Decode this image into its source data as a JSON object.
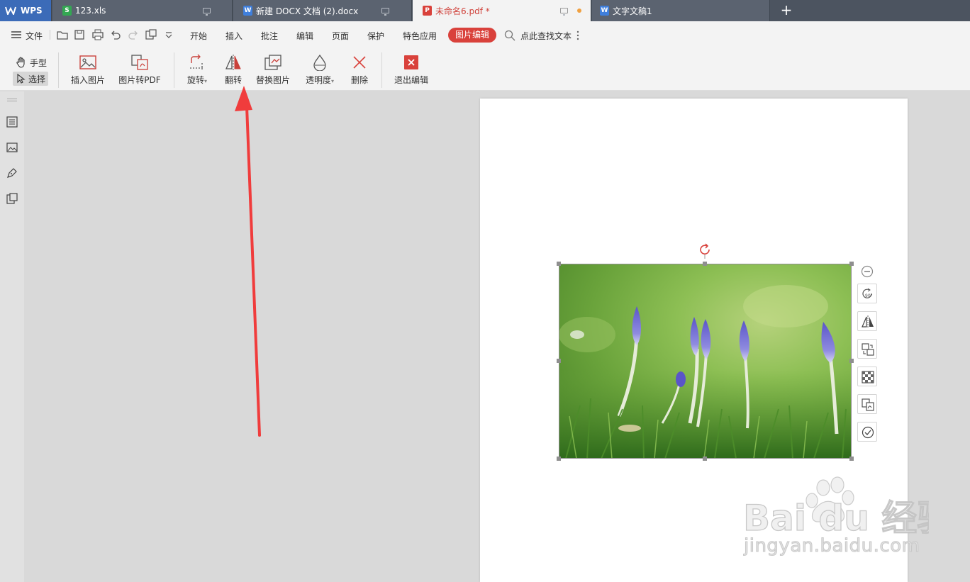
{
  "tabs": [
    {
      "label": "WPS",
      "kind": "home"
    },
    {
      "label": "123.xls",
      "kind": "sheet"
    },
    {
      "label": "新建 DOCX 文档 (2).docx",
      "kind": "doc"
    },
    {
      "label": "未命名6.pdf *",
      "kind": "pdf",
      "active": true
    },
    {
      "label": "文字文稿1",
      "kind": "doc"
    }
  ],
  "menu": {
    "file": "文件",
    "items": [
      "开始",
      "插入",
      "批注",
      "编辑",
      "页面",
      "保护",
      "特色应用"
    ],
    "active_item": "图片编辑",
    "search": "点此查找文本"
  },
  "ribbon": {
    "mode_hand": "手型",
    "mode_select": "选择",
    "buttons": [
      "插入图片",
      "图片转PDF",
      "旋转",
      "翻转",
      "替换图片",
      "透明度",
      "删除",
      "退出编辑"
    ]
  },
  "watermark": {
    "brand": "Bai du 经验",
    "domain": "jingyan.baidu.com"
  },
  "colors": {
    "accent": "#d9413b",
    "tabbar": "#4c5460",
    "wps_tab": "#3b6bb8",
    "arrow": "#f03c3c"
  },
  "icons": {
    "float_toolbar": [
      "minus-circle-icon",
      "rotate-90-icon",
      "flip-icon",
      "replace-image-icon",
      "transparency-icon",
      "image-to-pdf-icon",
      "finish-check-icon"
    ]
  }
}
